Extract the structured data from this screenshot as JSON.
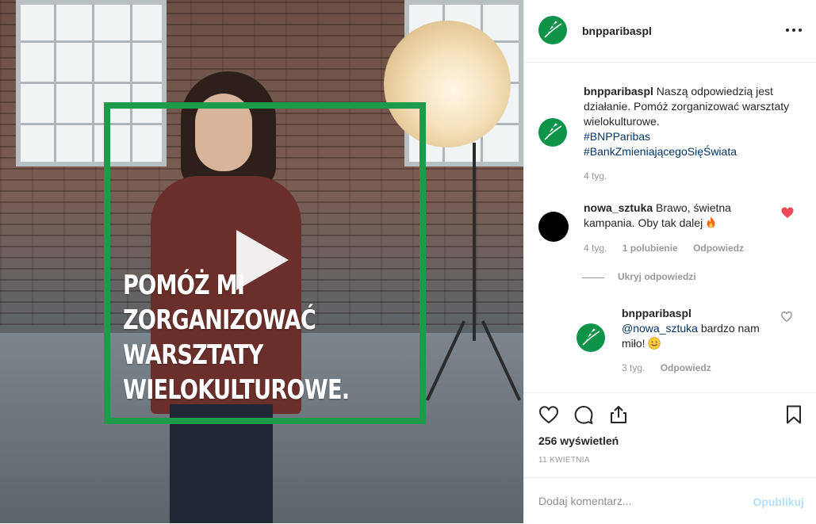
{
  "post": {
    "overlay_text": "POMÓŻ MI\nZORGANIZOWAĆ\nWARSZTATY\nWIELOKULTUROWE.",
    "brand_green": "#1e9a4b"
  },
  "header": {
    "username": "bnpparibaspl",
    "more_icon": "more-horizontal-icon"
  },
  "caption": {
    "username": "bnpparibaspl",
    "text": "Naszą odpowiedzią jest działanie. Pomóż zorganizować warsztaty wielokulturowe.",
    "hashtags": [
      "#BNPParibas",
      "#BankZmieniającegoSięŚwiata"
    ],
    "time": "4 tyg."
  },
  "comments": [
    {
      "username": "nowa_sztuka",
      "text": "Brawo, świetna kampania. Oby tak dalej",
      "emoji": "fire-icon",
      "time": "4 tyg.",
      "likes": "1 polubienie",
      "reply_label": "Odpowiedz",
      "liked": true
    }
  ],
  "hide_replies": "Ukryj odpowiedzi",
  "reply": {
    "username": "bnpparibaspl",
    "mention": "@nowa_sztuka",
    "text": "bardzo nam miło!",
    "emoji": "smiling-face-icon",
    "time": "3 tyg.",
    "reply_label": "Odpowiedz"
  },
  "actions": {
    "icons": [
      "heart-icon",
      "comment-icon",
      "share-icon",
      "bookmark-icon"
    ],
    "views": "256 wyświetleń",
    "date": "11 KWIETNIA"
  },
  "add_comment": {
    "placeholder": "Dodaj komentarz...",
    "publish_label": "Opublikuj",
    "publish_color": "#b2dffc"
  }
}
